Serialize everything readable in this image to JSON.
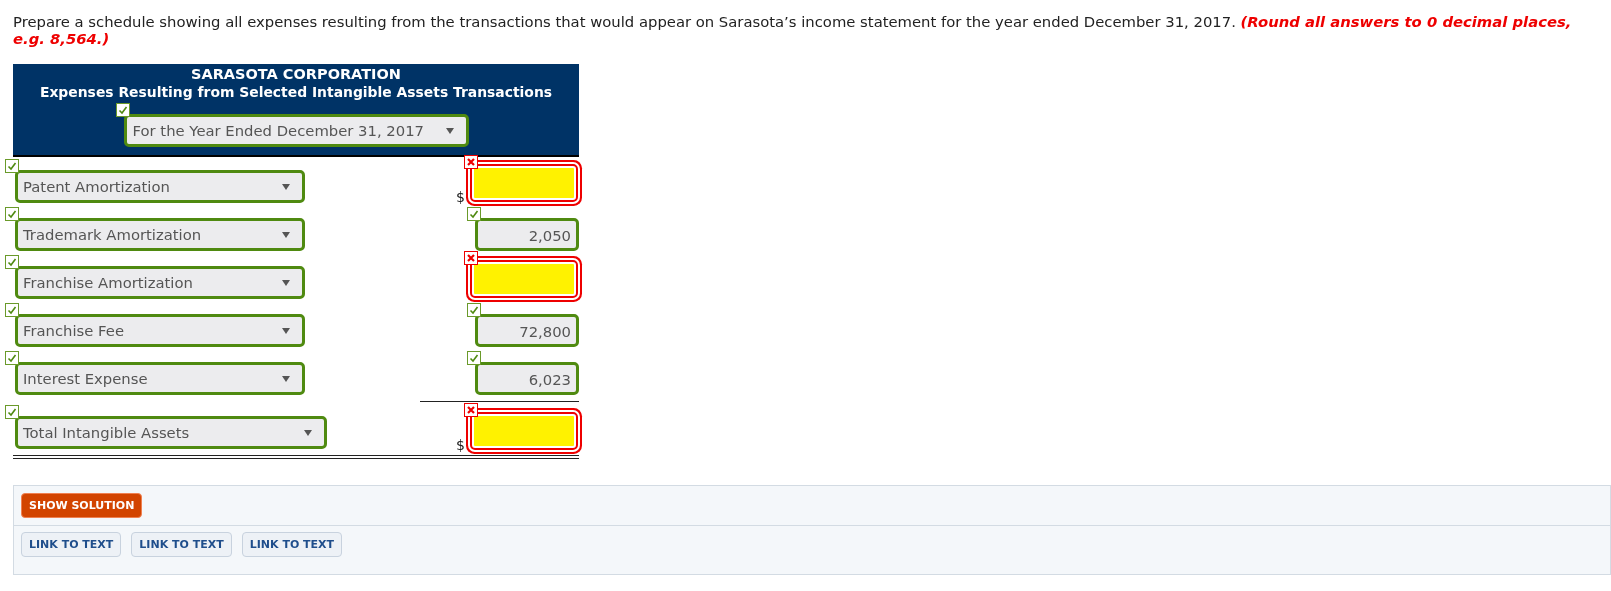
{
  "question": {
    "text": "Prepare a schedule showing all expenses resulting from the transactions that would appear on Sarasota’s income statement for the year ended December 31, 2017. **(Round all answers to 0 decimal places, e.g. 8,564.)**"
  },
  "schedule": {
    "company": "SARASOTA CORPORATION",
    "title": "Expenses Resulting from Selected Intangible Assets Transactions",
    "period": {
      "value": "For the Year Ended December 31, 2017",
      "correct": true
    },
    "rows": [
      {
        "kind": "item",
        "label": "Patent Amortization",
        "label_correct": true,
        "currency": "$",
        "amount_correct": false
      },
      {
        "kind": "item",
        "label": "Trademark Amortization",
        "label_correct": true,
        "amount": "2,050",
        "amount_correct": true
      },
      {
        "kind": "item",
        "label": "Franchise Amortization",
        "label_correct": true,
        "amount_correct": false
      },
      {
        "kind": "item",
        "label": "Franchise Fee",
        "label_correct": true,
        "amount": "72,800",
        "amount_correct": true
      },
      {
        "kind": "item",
        "label": "Interest Expense",
        "label_correct": true,
        "amount": "6,023",
        "amount_correct": true
      },
      {
        "kind": "total",
        "label": "Total Intangible Assets",
        "label_correct": true,
        "currency": "$",
        "amount_correct": false
      }
    ]
  },
  "actions": {
    "solution_button": "SHOW SOLUTION",
    "links": [
      "LINK TO TEXT",
      "LINK TO TEXT",
      "LINK TO TEXT"
    ]
  }
}
